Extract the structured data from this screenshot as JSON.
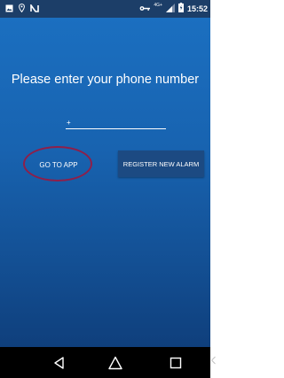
{
  "statusbar": {
    "time": "15:52",
    "network_label": "4G+",
    "icons": [
      "gallery-icon",
      "location-icon",
      "nfc-icon",
      "vpn-key-icon",
      "signal-icon",
      "battery-icon"
    ]
  },
  "main": {
    "prompt": "Please enter your phone number",
    "phone_input": {
      "value": "",
      "placeholder": "+"
    },
    "go_button": "GO TO APP",
    "register_button": "REGISTER NEW ALARM"
  },
  "navbar": {
    "icons": [
      "back-icon",
      "home-icon",
      "recent-apps-icon"
    ]
  },
  "colors": {
    "statusbar": "#1c3e68",
    "background_top": "#1b6fc0",
    "background_bottom": "#0f3f7c",
    "register_button": "#1c4a82",
    "highlight_ring": "#8e1f4a",
    "navbar": "#000000"
  }
}
